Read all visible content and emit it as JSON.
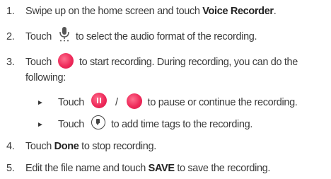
{
  "steps": [
    {
      "number": "1.",
      "text_before": "Swipe up on the home screen and touch ",
      "bold": "Voice Recorder",
      "text_after": "."
    },
    {
      "number": "2.",
      "text_before": "Touch",
      "icon": "microphone-format-icon",
      "text_after": "to select the audio format of the recording."
    },
    {
      "number": "3.",
      "text_before": "Touch",
      "icon": "record-icon",
      "text_after": "to start recording. During recording, you can do the",
      "text_line2": "following:",
      "sub_items": [
        {
          "text_before": "Touch",
          "icon_a": "pause-icon",
          "separator": "/",
          "icon_b": "record-icon",
          "text_after": "to pause or continue the recording."
        },
        {
          "text_before": "Touch",
          "icon_a": "time-tag-icon",
          "text_after": "to add time tags to the recording."
        }
      ]
    },
    {
      "number": "4.",
      "text_before": "Touch ",
      "bold": "Done",
      "text_after": " to stop recording."
    },
    {
      "number": "5.",
      "text_before": "Edit the file name and touch ",
      "bold": "SAVE",
      "text_after": " to save the recording."
    }
  ],
  "bullet_glyph": "►",
  "colors": {
    "text": "#3a3a3a",
    "record_red": "#ee2a5a",
    "icon_dark": "#444444"
  }
}
